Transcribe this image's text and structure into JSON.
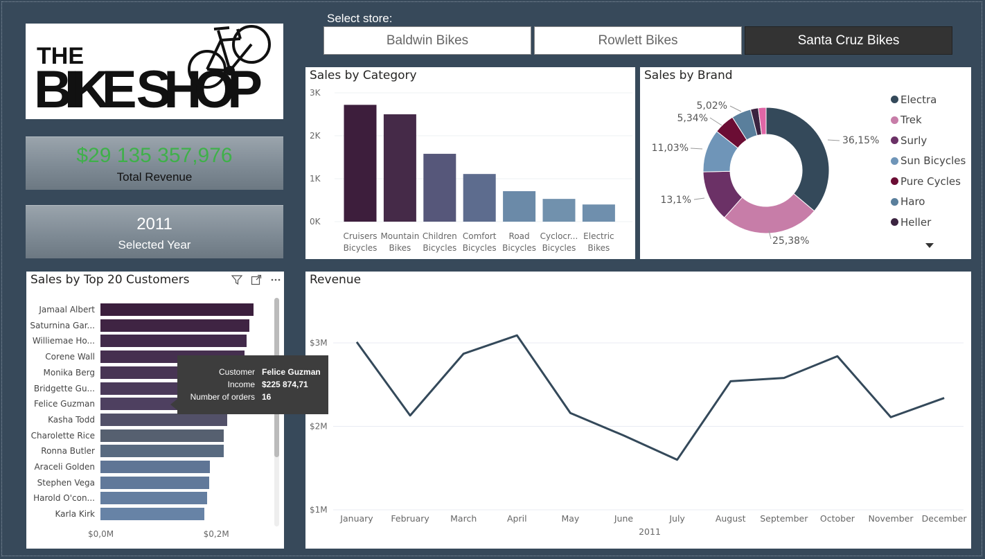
{
  "store_selector": {
    "label": "Select store:",
    "stores": [
      {
        "label": "Baldwin Bikes",
        "selected": false
      },
      {
        "label": "Rowlett Bikes",
        "selected": false
      },
      {
        "label": "Santa Cruz Bikes",
        "selected": true
      }
    ]
  },
  "logo": {
    "line1": "THE",
    "line2": "BIKE SHOP"
  },
  "kpis": {
    "revenue": {
      "value": "$29 135 357,976",
      "label": "Total Revenue",
      "color": "#3fb04a"
    },
    "year": {
      "value": "2011",
      "label": "Selected Year"
    }
  },
  "icons": {
    "filter": "filter-icon",
    "focus": "focus-mode-icon",
    "more": "more-options-icon",
    "dropdown": "dropdown-arrow-icon"
  },
  "chart_data": [
    {
      "id": "sales_by_category",
      "type": "bar",
      "title": "Sales by Category",
      "categories": [
        [
          "Cruisers",
          "Bicycles"
        ],
        [
          "Mountain",
          "Bikes"
        ],
        [
          "Children",
          "Bicycles"
        ],
        [
          "Comfort",
          "Bicycles"
        ],
        [
          "Road",
          "Bicycles"
        ],
        [
          "Cyclocr...",
          "Bicycles"
        ],
        [
          "Electric",
          "Bikes"
        ]
      ],
      "values": [
        2720,
        2500,
        1580,
        1110,
        710,
        530,
        400
      ],
      "colors": [
        "#3d1e3c",
        "#452a48",
        "#56577a",
        "#5d6c8e",
        "#6b8aa8",
        "#7191ad",
        "#6f8fad"
      ],
      "yticks": [
        "0K",
        "1K",
        "2K",
        "3K"
      ],
      "ylim": [
        0,
        3000
      ]
    },
    {
      "id": "sales_by_brand",
      "type": "pie",
      "title": "Sales by Brand",
      "slices": [
        {
          "name": "Electra",
          "value": 36.15,
          "label": "36,15%",
          "color": "#34495a"
        },
        {
          "name": "Trek",
          "value": 25.38,
          "label": "25,38%",
          "color": "#c77da8"
        },
        {
          "name": "Surly",
          "value": 13.1,
          "label": "13,1%",
          "color": "#6b3166"
        },
        {
          "name": "Sun Bicycles",
          "value": 11.03,
          "label": "11,03%",
          "color": "#6f95b8"
        },
        {
          "name": "Pure Cycles",
          "value": 5.34,
          "label": "5,34%",
          "color": "#6b0d34"
        },
        {
          "name": "Haro",
          "value": 5.02,
          "label": "5,02%",
          "color": "#5a7f9c"
        },
        {
          "name": "Heller",
          "value": 2.0,
          "label": "",
          "color": "#3b2340"
        },
        {
          "name": "",
          "value": 1.98,
          "label": "",
          "color": "#e066a6"
        }
      ],
      "legend": [
        "Electra",
        "Trek",
        "Surly",
        "Sun Bicycles",
        "Pure Cycles",
        "Haro",
        "Heller"
      ],
      "legend_colors": [
        "#34495a",
        "#c77da8",
        "#6b3166",
        "#6f95b8",
        "#6b0d34",
        "#5a7f9c",
        "#3b2340"
      ]
    },
    {
      "id": "sales_by_top_customers",
      "type": "bar",
      "orientation": "horizontal",
      "title": "Sales by Top 20 Customers",
      "categories": [
        "Jamaal Albert",
        "Saturnina Gar...",
        "Williemae Ho...",
        "Corene Wall",
        "Monika Berg",
        "Bridgette Gu...",
        "Felice Guzman",
        "Kasha Todd",
        "Charolette Rice",
        "Ronna Butler",
        "Araceli Golden",
        "Stephen Vega",
        "Harold O'con...",
        "Karla Kirk"
      ],
      "values": [
        0.265,
        0.258,
        0.253,
        0.25,
        0.245,
        0.238,
        0.226,
        0.22,
        0.214,
        0.214,
        0.19,
        0.188,
        0.185,
        0.18
      ],
      "colors": [
        "#3b1f3d",
        "#3f2443",
        "#422a4a",
        "#452f4f",
        "#483554",
        "#4b3a5a",
        "#4e4060",
        "#525068",
        "#566070",
        "#586a80",
        "#5f7595",
        "#61799a",
        "#647ea0",
        "#6783a6"
      ],
      "xticks": [
        "$0,0M",
        "$0,2M"
      ],
      "xlim": [
        0,
        0.3
      ]
    },
    {
      "id": "revenue",
      "type": "line",
      "title": "Revenue",
      "x": [
        "January",
        "February",
        "March",
        "April",
        "May",
        "June",
        "July",
        "August",
        "September",
        "October",
        "November",
        "December"
      ],
      "y": [
        3.01,
        2.13,
        2.87,
        3.09,
        2.16,
        1.89,
        1.6,
        2.54,
        2.58,
        2.84,
        2.11,
        2.34
      ],
      "yticks": [
        "$1M",
        "$2M",
        "$3M"
      ],
      "ylim": [
        1,
        3.2
      ],
      "xlabel": "2011",
      "color": "#34495a"
    }
  ],
  "tooltip": {
    "rows": [
      {
        "key": "Customer",
        "value": "Felice Guzman"
      },
      {
        "key": "Income",
        "value": "$225 874,71"
      },
      {
        "key": "Number of orders",
        "value": "16"
      }
    ]
  }
}
